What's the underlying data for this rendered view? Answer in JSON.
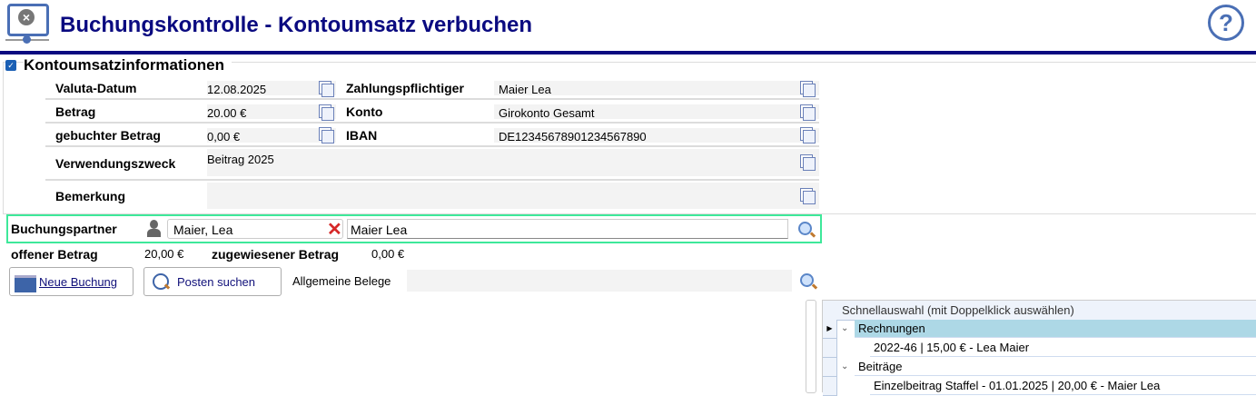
{
  "header": {
    "title": "Buchungskontrolle - Kontoumsatz verbuchen",
    "help_icon": "help-icon",
    "app_icon": "monitor-cancel-icon"
  },
  "section": {
    "title": "Kontoumsatzinformationen",
    "checked": true,
    "valuta_label": "Valuta-Datum",
    "valuta": "12.08.2025",
    "betrag_label": "Betrag",
    "betrag": "20.00 €",
    "gebucht_label": "gebuchter Betrag",
    "gebucht": "0,00 €",
    "zahler_label": "Zahlungspflichtiger",
    "zahler": "Maier Lea",
    "konto_label": "Konto",
    "konto": "Girokonto Gesamt",
    "iban_label": "IBAN",
    "iban": "DE12345678901234567890",
    "zweck_label": "Verwendungszweck",
    "zweck": "Beitrag 2025",
    "bemerkung_label": "Bemerkung",
    "bemerkung": ""
  },
  "partner": {
    "label": "Buchungspartner",
    "value": "Maier, Lea",
    "name": "Maier Lea",
    "accent": "#3ee89a"
  },
  "amounts": {
    "offen_label": "offener Betrag",
    "offen": "20,00 €",
    "zugewiesen_label": "zugewiesener Betrag",
    "zugewiesen": "0,00 €"
  },
  "actions": {
    "neue_buchung": "Neue Buchung",
    "posten_suchen": "Posten suchen",
    "belege_label": "Allgemeine Belege",
    "belege": ""
  },
  "grid": {
    "header": "Schnellauswahl (mit Doppelklick auswählen)",
    "rows": [
      {
        "label": "Rechnungen",
        "level": 0
      },
      {
        "label": "2022-46 | 15,00 € - Lea Maier",
        "level": 1
      },
      {
        "label": "Beiträge",
        "level": 0
      },
      {
        "label": "Einzelbeitrag Staffel - 01.01.2025 | 20,00 € - Maier Lea",
        "level": 1
      }
    ]
  }
}
